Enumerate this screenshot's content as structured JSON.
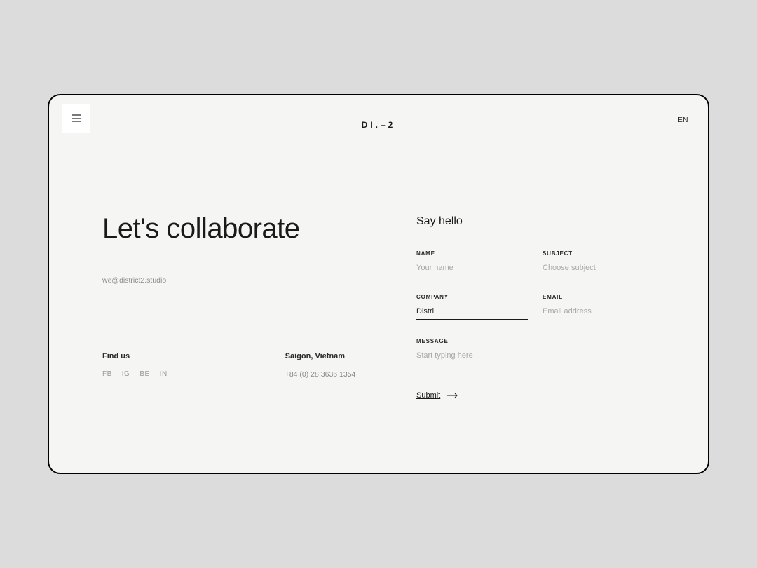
{
  "header": {
    "logo": "DI.–2",
    "lang": "EN"
  },
  "left": {
    "headline": "Let's collaborate",
    "email": "we@district2.studio"
  },
  "findus": {
    "heading": "Find us",
    "socials": {
      "fb": "FB",
      "ig": "IG",
      "be": "BE",
      "in": "IN"
    }
  },
  "location": {
    "heading": "Saigon, Vietnam",
    "phone": "+84 (0) 28 3636 1354"
  },
  "form": {
    "title": "Say hello",
    "name": {
      "label": "NAME",
      "placeholder": "Your name"
    },
    "subject": {
      "label": "SUBJECT",
      "placeholder": "Choose subject"
    },
    "company": {
      "label": "COMPANY",
      "value": "Distri"
    },
    "email": {
      "label": "EMAIL",
      "placeholder": "Email address"
    },
    "message": {
      "label": "MESSAGE",
      "placeholder": "Start typing here"
    },
    "submit": "Submit"
  }
}
